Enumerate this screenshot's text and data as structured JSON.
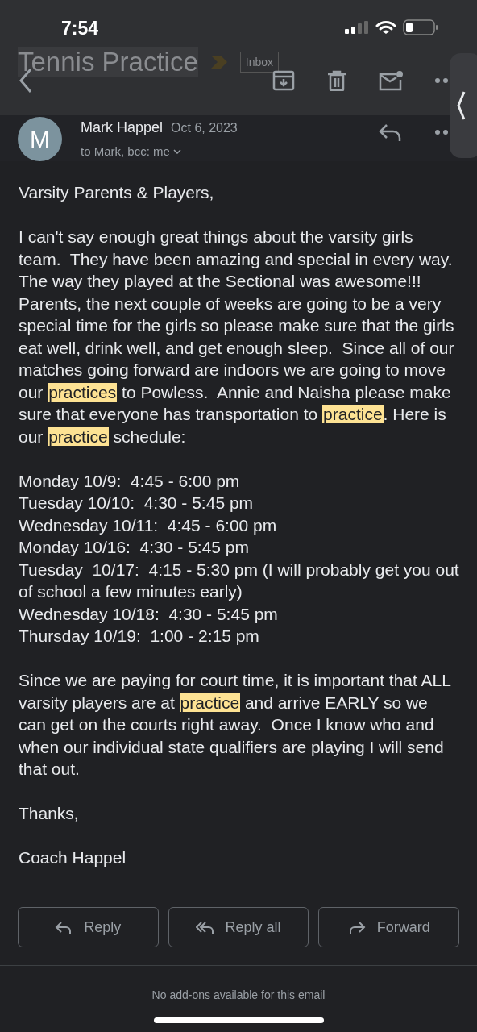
{
  "status_bar": {
    "time": "7:54"
  },
  "toolbar": {
    "subject": "Tennis Practice",
    "label": "Inbox"
  },
  "message": {
    "avatar_letter": "M",
    "sender": "Mark Happel",
    "date": "Oct 6, 2023",
    "recipients": "to Mark, bcc: me",
    "body": [
      {
        "kind": "paragraph",
        "segments": [
          {
            "text": "Varsity Parents & Players,",
            "highlight": false
          }
        ]
      },
      {
        "kind": "paragraph",
        "segments": [
          {
            "text": "I can't say enough great things about the varsity girls team.  They have been amazing and special in every way.  The way they played at the Sectional was awesome!!!  Parents, the next couple of weeks are going to be a very special time for the girls so please make sure that the girls eat well, drink well, and get enough sleep.  Since all of our matches going forward are indoors we are going to move our ",
            "highlight": false
          },
          {
            "text": "practices",
            "highlight": true
          },
          {
            "text": " to Powless.  Annie and Naisha please make sure that everyone has transportation to ",
            "highlight": false
          },
          {
            "text": "practice",
            "highlight": true
          },
          {
            "text": ". Here is our ",
            "highlight": false
          },
          {
            "text": "practice",
            "highlight": true
          },
          {
            "text": " schedule:",
            "highlight": false
          }
        ]
      },
      {
        "kind": "lines",
        "lines": [
          "Monday 10/9:  4:45 - 6:00 pm",
          "Tuesday 10/10:  4:30 - 5:45 pm",
          "Wednesday 10/11:  4:45 - 6:00 pm",
          "Monday 10/16:  4:30 - 5:45 pm",
          "Tuesday  10/17:  4:15 - 5:30 pm (I will probably get you out of school a few minutes early)",
          "Wednesday 10/18:  4:30 - 5:45 pm",
          "Thursday 10/19:  1:00 - 2:15 pm"
        ]
      },
      {
        "kind": "paragraph",
        "segments": [
          {
            "text": "Since we are paying for court time, it is important that ALL varsity players are at ",
            "highlight": false
          },
          {
            "text": "practice",
            "highlight": true
          },
          {
            "text": " and arrive EARLY so we can get on the courts right away.  Once I know who and when our individual state qualifiers are playing I will send that out.",
            "highlight": false
          }
        ]
      },
      {
        "kind": "paragraph",
        "segments": [
          {
            "text": "Thanks,",
            "highlight": false
          }
        ]
      },
      {
        "kind": "paragraph",
        "segments": [
          {
            "text": "Coach Happel",
            "highlight": false
          }
        ]
      }
    ]
  },
  "actions": [
    {
      "kind": "reply",
      "label": "Reply"
    },
    {
      "kind": "reply_all",
      "label": "Reply all"
    },
    {
      "kind": "forward",
      "label": "Forward"
    }
  ],
  "footer": {
    "note": "No add-ons available for this email"
  }
}
